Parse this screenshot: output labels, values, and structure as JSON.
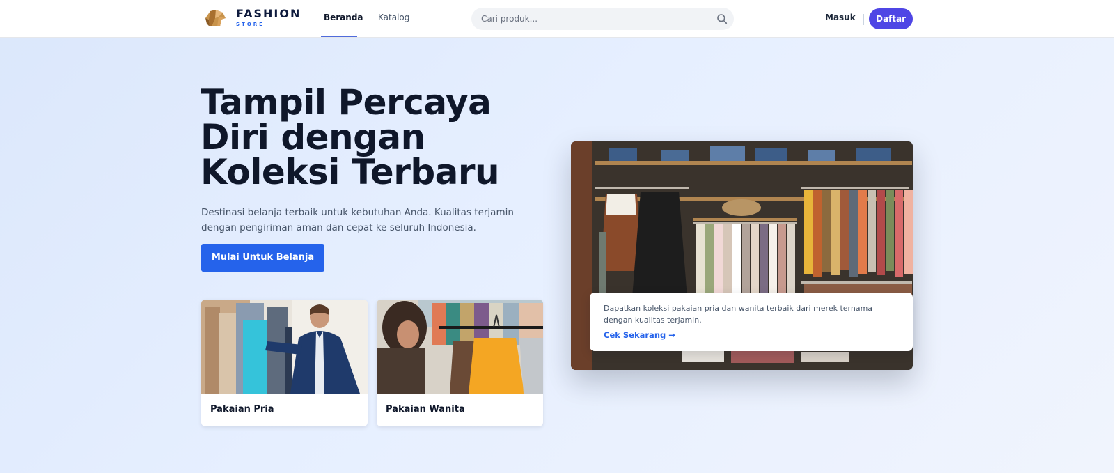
{
  "nav": {
    "logo_title": "FASHION",
    "logo_sub": "STORE",
    "links": [
      {
        "label": "Beranda",
        "active": true
      },
      {
        "label": "Katalog",
        "active": false
      }
    ],
    "search_placeholder": "Cari produk...",
    "login_label": "Masuk",
    "register_label": "Daftar",
    "accent_color": "#4f46e5"
  },
  "hero": {
    "title": "Tampil Percaya Diri dengan Koleksi Terbaru",
    "description": "Destinasi belanja terbaik untuk kebutuhan Anda. Kualitas terjamin dengan pengiriman aman dan cepat ke seluruh Indonesia.",
    "cta_label": "Mulai Untuk Belanja",
    "cta_color": "#2563eb"
  },
  "categories": [
    {
      "label": "Pakaian Pria",
      "image": "man-shopping-photo"
    },
    {
      "label": "Pakaian Wanita",
      "image": "woman-shopping-photo"
    }
  ],
  "feature": {
    "image": "clothing-store-rack-photo",
    "promo_text": "Dapatkan koleksi pakaian pria dan wanita terbaik dari merek ternama dengan kualitas terjamin.",
    "promo_link": "Cek Sekarang →"
  }
}
